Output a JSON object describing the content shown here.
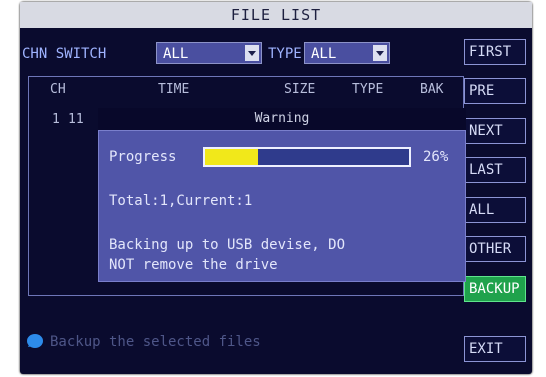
{
  "title": "FILE LIST",
  "filters": {
    "chn_label": "CHN SWITCH",
    "chn_value": "ALL",
    "type_label": "TYPE",
    "type_value": "ALL"
  },
  "list": {
    "headers": [
      "CH",
      "TIME",
      "SIZE",
      "TYPE",
      "BAK"
    ],
    "rows": [
      {
        "ch": "1",
        "time": "11"
      }
    ]
  },
  "buttons": [
    "FIRST",
    "PRE",
    "NEXT",
    "LAST",
    "ALL",
    "OTHER",
    "BACKUP",
    "EXIT"
  ],
  "active_button": "BACKUP",
  "dialog": {
    "title": "Warning",
    "progress_label": "Progress",
    "progress_percent": 26,
    "progress_text": "26%",
    "info": "Total:1,Current:1",
    "message_line1": "Backing up to USB devise, DO",
    "message_line2": "NOT remove the drive"
  },
  "hint": "Backup the selected files",
  "colors": {
    "accent": "#1fa24c",
    "progress_fill": "#f1e81a",
    "dialog_bg": "#5055a8",
    "screen_bg": "#0a0b2e"
  }
}
